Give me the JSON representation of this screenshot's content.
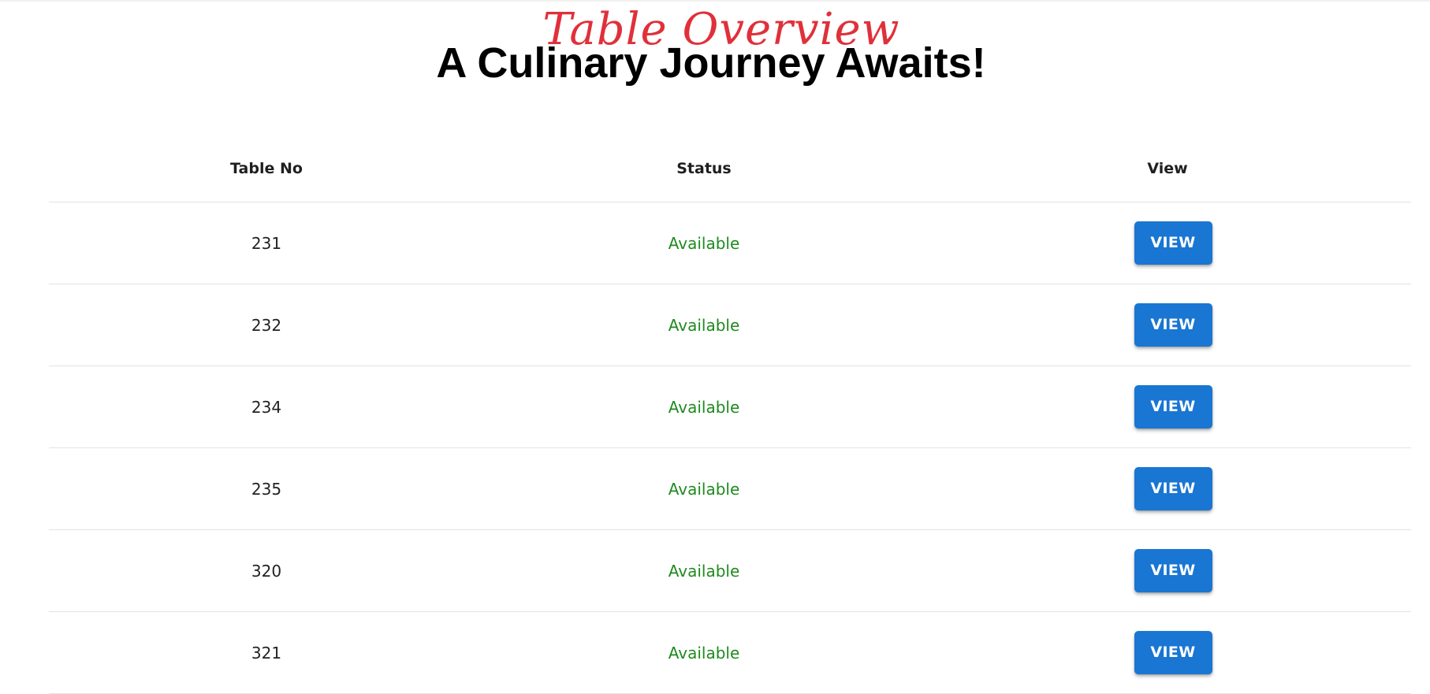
{
  "header": {
    "script_title": "Table Overview",
    "main_title": "A Culinary Journey Awaits!"
  },
  "table": {
    "columns": [
      "Table No",
      "Status",
      "View"
    ],
    "rows": [
      {
        "table_no": "231",
        "status": "Available",
        "action": "VIEW"
      },
      {
        "table_no": "232",
        "status": "Available",
        "action": "VIEW"
      },
      {
        "table_no": "234",
        "status": "Available",
        "action": "VIEW"
      },
      {
        "table_no": "235",
        "status": "Available",
        "action": "VIEW"
      },
      {
        "table_no": "320",
        "status": "Available",
        "action": "VIEW"
      },
      {
        "table_no": "321",
        "status": "Available",
        "action": "VIEW"
      }
    ]
  },
  "colors": {
    "script_title": "#e0303a",
    "status_available": "#1f8a1f",
    "button_bg": "#1976d2",
    "button_text": "#ffffff"
  }
}
